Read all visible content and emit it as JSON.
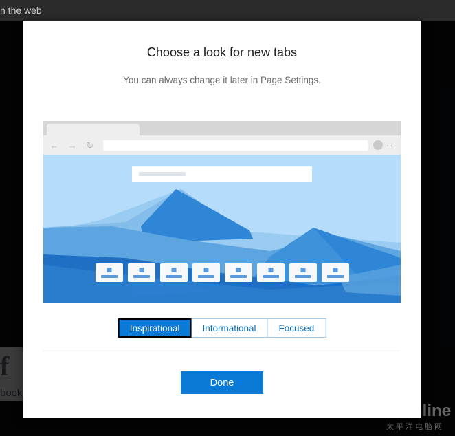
{
  "background": {
    "topbar_text": "n the web",
    "facebook_logo": "f",
    "facebook_label": "book"
  },
  "watermark": {
    "main": "PConline",
    "sub": "太平洋电脑网"
  },
  "dialog": {
    "title": "Choose a look for new tabs",
    "subtitle": "You can always change it later in Page Settings.",
    "done_label": "Done"
  },
  "preview": {
    "nav": {
      "back": "←",
      "forward": "→",
      "reload": "↻",
      "more": "···"
    },
    "address_value": "",
    "search_placeholder": "",
    "tiles": [
      {
        "label": ""
      },
      {
        "label": ""
      },
      {
        "label": ""
      },
      {
        "label": ""
      },
      {
        "label": ""
      },
      {
        "label": ""
      },
      {
        "label": ""
      },
      {
        "label": ""
      }
    ]
  },
  "style_options": [
    {
      "label": "Inspirational",
      "selected": true
    },
    {
      "label": "Informational",
      "selected": false
    },
    {
      "label": "Focused",
      "selected": false
    }
  ],
  "colors": {
    "accent": "#0a7ad6",
    "sky": "#b5dcfb",
    "mountain_light": "#8cc3ee",
    "mountain_mid": "#5fa8e0",
    "mountain_dark": "#2b7fd4",
    "foreground": "#1f6fc4",
    "dialog_bg": "#ffffff",
    "overlay": "rgba(0,0,0,0.78)"
  }
}
